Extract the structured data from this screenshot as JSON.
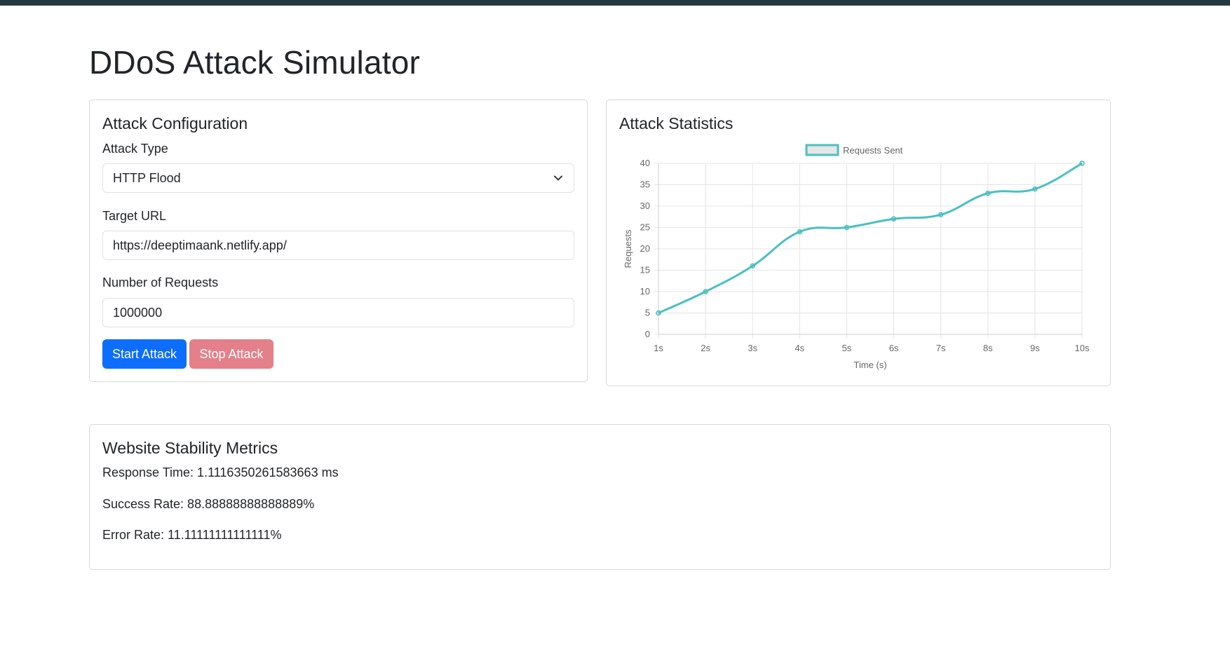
{
  "page": {
    "title": "DDoS Attack Simulator"
  },
  "config": {
    "title": "Attack Configuration",
    "attack_type_label": "Attack Type",
    "attack_type_value": "HTTP Flood",
    "target_url_label": "Target URL",
    "target_url_value": "https://deeptimaank.netlify.app/",
    "requests_label": "Number of Requests",
    "requests_value": "1000000",
    "start_label": "Start Attack",
    "stop_label": "Stop Attack"
  },
  "stats": {
    "title": "Attack Statistics"
  },
  "chart_data": {
    "type": "line",
    "categories": [
      "1s",
      "2s",
      "3s",
      "4s",
      "5s",
      "6s",
      "7s",
      "8s",
      "9s",
      "10s"
    ],
    "series": [
      {
        "name": "Requests Sent",
        "values": [
          5,
          10,
          16,
          24,
          25,
          27,
          28,
          33,
          34,
          40
        ]
      }
    ],
    "xlabel": "Time (s)",
    "ylabel": "Requests",
    "ylim": [
      0,
      40
    ],
    "yticks": [
      0,
      5,
      10,
      15,
      20,
      25,
      30,
      35,
      40
    ],
    "grid": true,
    "legend": "top",
    "colors": {
      "line": "#4bc0c0",
      "legend_fill": "#e6e6e6"
    }
  },
  "metrics": {
    "title": "Website Stability Metrics",
    "response_time": "Response Time: 1.1116350261583663 ms",
    "success_rate": "Success Rate: 88.88888888888889%",
    "error_rate": "Error Rate: 11.11111111111111%"
  },
  "colors": {
    "primary": "#0d6efd",
    "danger_disabled": "#e4808a",
    "topbar": "#24393f"
  },
  "icons": {
    "select_arrow": "chevron-down-icon"
  }
}
